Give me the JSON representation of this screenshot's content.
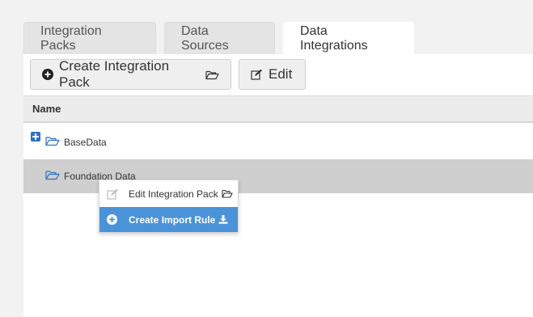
{
  "tabs": [
    {
      "label": "Integration Packs",
      "active": false
    },
    {
      "label": "Data Sources",
      "active": false
    },
    {
      "label": "Data Integrations",
      "active": true
    }
  ],
  "toolbar": {
    "create_label": "Create Integration Pack",
    "edit_label": "Edit"
  },
  "table": {
    "header": "Name",
    "rows": [
      {
        "label": "BaseData",
        "expandable": true,
        "selected": false
      },
      {
        "label": "Foundation Data",
        "expandable": false,
        "selected": true
      }
    ]
  },
  "context_menu": {
    "items": [
      {
        "label": "Edit Integration Pack",
        "icon": "edit-icon",
        "highlighted": false
      },
      {
        "label": "Create Import Rule",
        "icon": "plus-circle-icon",
        "highlighted": true
      }
    ]
  },
  "colors": {
    "accent": "#4b93d8",
    "expand_box": "#2f6fc1",
    "selected_row": "#cfcfcf"
  }
}
